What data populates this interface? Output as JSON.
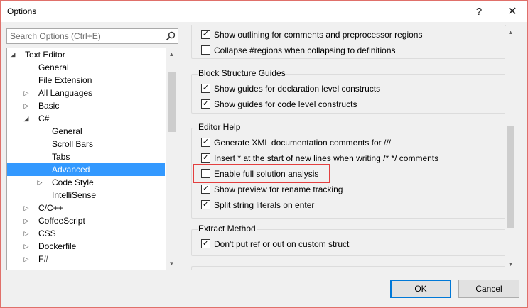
{
  "window": {
    "title": "Options",
    "help_label": "?",
    "close_label": "✕"
  },
  "search": {
    "placeholder": "Search Options (Ctrl+E)"
  },
  "tree": {
    "items": [
      {
        "label": "Text Editor",
        "level": 0,
        "toggle": "◢"
      },
      {
        "label": "General",
        "level": 1,
        "toggle": ""
      },
      {
        "label": "File Extension",
        "level": 1,
        "toggle": ""
      },
      {
        "label": "All Languages",
        "level": 1,
        "toggle": "▷"
      },
      {
        "label": "Basic",
        "level": 1,
        "toggle": "▷"
      },
      {
        "label": "C#",
        "level": 1,
        "toggle": "◢"
      },
      {
        "label": "General",
        "level": 2,
        "toggle": ""
      },
      {
        "label": "Scroll Bars",
        "level": 2,
        "toggle": ""
      },
      {
        "label": "Tabs",
        "level": 2,
        "toggle": ""
      },
      {
        "label": "Advanced",
        "level": 2,
        "toggle": "",
        "selected": true
      },
      {
        "label": "Code Style",
        "level": 2,
        "toggle": "▷"
      },
      {
        "label": "IntelliSense",
        "level": 2,
        "toggle": ""
      },
      {
        "label": "C/C++",
        "level": 1,
        "toggle": "▷"
      },
      {
        "label": "CoffeeScript",
        "level": 1,
        "toggle": "▷"
      },
      {
        "label": "CSS",
        "level": 1,
        "toggle": "▷"
      },
      {
        "label": "Dockerfile",
        "level": 1,
        "toggle": "▷"
      },
      {
        "label": "F#",
        "level": 1,
        "toggle": "▷"
      }
    ]
  },
  "outlining": {
    "opt1": "Show outlining for comments and preprocessor regions",
    "opt2": "Collapse #regions when collapsing to definitions"
  },
  "block_guides": {
    "title": "Block Structure Guides",
    "opt1": "Show guides for declaration level constructs",
    "opt2": "Show guides for code level constructs"
  },
  "editor_help": {
    "title": "Editor Help",
    "opt1": "Generate XML documentation comments for ///",
    "opt2": "Insert * at the start of new lines when writing /* */ comments",
    "opt3": "Enable full solution analysis",
    "opt4": "Show preview for rename tracking",
    "opt5": "Split string literals on enter"
  },
  "extract_method": {
    "title": "Extract Method",
    "opt1": "Don't put ref or out on custom struct"
  },
  "buttons": {
    "ok": "OK",
    "cancel": "Cancel"
  },
  "check": "✓"
}
